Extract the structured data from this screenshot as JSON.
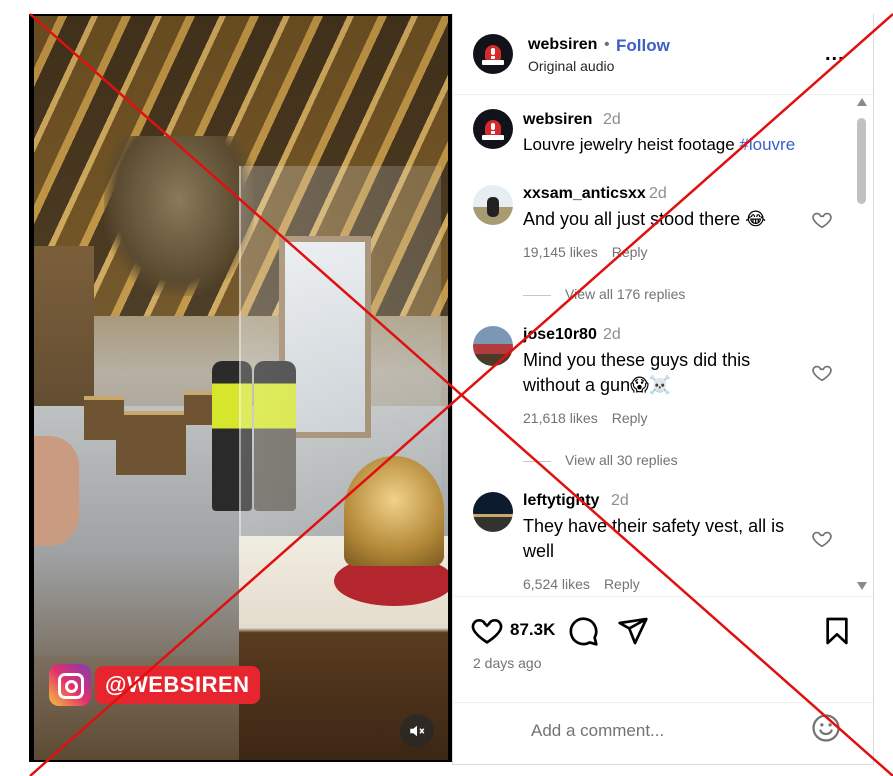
{
  "post": {
    "username": "websiren",
    "separator": "•",
    "follow_label": "Follow",
    "audio": "Original audio",
    "more_label": "...",
    "caption_time": "2d",
    "caption_text": "Louvre jewelry heist footage ",
    "caption_tag": "#louvre"
  },
  "comments": [
    {
      "username": "xxsam_anticsxx",
      "time": "2d",
      "text": "And you all just stood there 😂",
      "likes": "19,145 likes",
      "reply": "Reply",
      "view_replies": "View all 176 replies"
    },
    {
      "username": "jose10r80",
      "time": "2d",
      "text": "Mind you these guys did this without a gun😱☠️",
      "likes": "21,618 likes",
      "reply": "Reply",
      "view_replies": "View all 30 replies"
    },
    {
      "username": "leftytighty",
      "time": "2d",
      "text": "They have their safety vest, all is well",
      "likes": "6,524 likes",
      "reply": "Reply"
    }
  ],
  "actions": {
    "like_count": "87.3K",
    "posted_ago": "2 days ago"
  },
  "add_comment": {
    "placeholder": "Add a comment..."
  },
  "watermark": {
    "handle": "@WEBSIREN"
  },
  "icons": {
    "like": "heart-icon",
    "comment": "comment-icon",
    "share": "send-icon",
    "save": "bookmark-icon",
    "emoji": "smiley-icon",
    "mute": "speaker-muted-icon",
    "more": "more-icon"
  },
  "colors": {
    "follow": "#3b5ec9",
    "hashtag": "#3b5ec9",
    "cross": "#e01010",
    "watermark_bg": "#e6252f"
  }
}
